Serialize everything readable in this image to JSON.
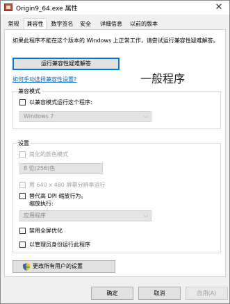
{
  "window": {
    "title": "Origin9_64.exe 属性",
    "close_glyph": "✕"
  },
  "tabs": [
    "常规",
    "兼容性",
    "数字签名",
    "安全",
    "详细信息",
    "以前的版本"
  ],
  "active_tab": "兼容性",
  "intro_text": "如果此程序不能在这个版本的 Windows 上正常工作，请尝试运行兼容性疑难解答。",
  "troubleshoot_button": "运行兼容性疑难解答",
  "manual_link": "如何手动选择兼容性设置?",
  "annotation": "一般程序",
  "compat_mode": {
    "group_label": "兼容模式",
    "checkbox_label": "以兼容模式运行这个程序:",
    "checked": false,
    "os_selected": "Windows 7"
  },
  "settings": {
    "group_label": "设置",
    "reduced_color_label": "简化的颜色模式",
    "reduced_color_checked": false,
    "color_value": "8 位(256)色",
    "resolution_label": "用 640 x 480 屏幕分辨率运行",
    "resolution_checked": false,
    "dpi_label_line1": "替代高 DPI 缩放行为。",
    "dpi_label_line2": "缩放执行:",
    "dpi_checked": false,
    "dpi_value": "应用程序",
    "fullscreen_label": "禁用全屏优化",
    "fullscreen_checked": false,
    "admin_label": "以管理员身份运行此程序",
    "admin_checked": false
  },
  "all_users_button": "更改所有用户的设置",
  "buttons": {
    "ok": "确定",
    "cancel": "取消",
    "apply": "应用(A)"
  },
  "colors": {
    "accent": "#0078d7",
    "link": "#0066cc",
    "disabled_text": "#a0a0a0"
  }
}
